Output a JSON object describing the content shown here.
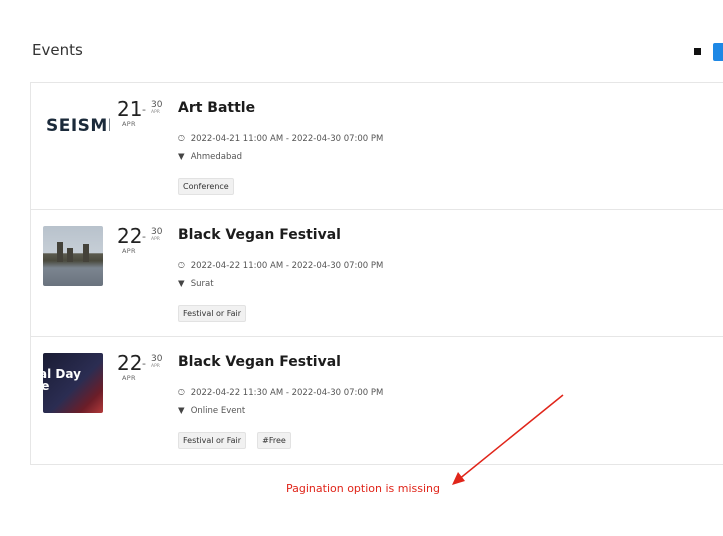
{
  "header": {
    "title": "Events"
  },
  "view_toggle": {
    "list_icon": "list-view-icon",
    "grid_icon": "grid-view-icon",
    "active_color": "#1e88e5"
  },
  "events": [
    {
      "thumbnail_type": "logo",
      "thumbnail_text": "SEISMI",
      "date_start": "21",
      "date_end": "30",
      "month": "APR",
      "end_month": "APR",
      "separator": "-",
      "title": "Art Battle",
      "time": "2022-04-21 11:00 AM - 2022-04-30 07:00 PM",
      "location": "Ahmedabad",
      "tags": [
        "Conference"
      ]
    },
    {
      "thumbnail_type": "photo",
      "date_start": "22",
      "date_end": "30",
      "month": "APR",
      "end_month": "APR",
      "separator": "-",
      "title": "Black Vegan Festival",
      "time": "2022-04-22 11:00 AM - 2022-04-30 07:00 PM",
      "location": "Surat",
      "tags": [
        "Festival or Fair"
      ]
    },
    {
      "thumbnail_type": "promo",
      "thumbnail_text": "rial Day ale",
      "date_start": "22",
      "date_end": "30",
      "month": "APR",
      "end_month": "APR",
      "separator": "-",
      "title": "Black Vegan Festival",
      "time": "2022-04-22 11:30 AM - 2022-04-30 07:00 PM",
      "location": "Online Event",
      "tags": [
        "Festival or Fair",
        "#Free"
      ]
    }
  ],
  "annotation": {
    "text": "Pagination option is missing",
    "color": "#e0251a"
  },
  "icons": {
    "time": "clock-icon",
    "location": "map-pin-icon"
  }
}
